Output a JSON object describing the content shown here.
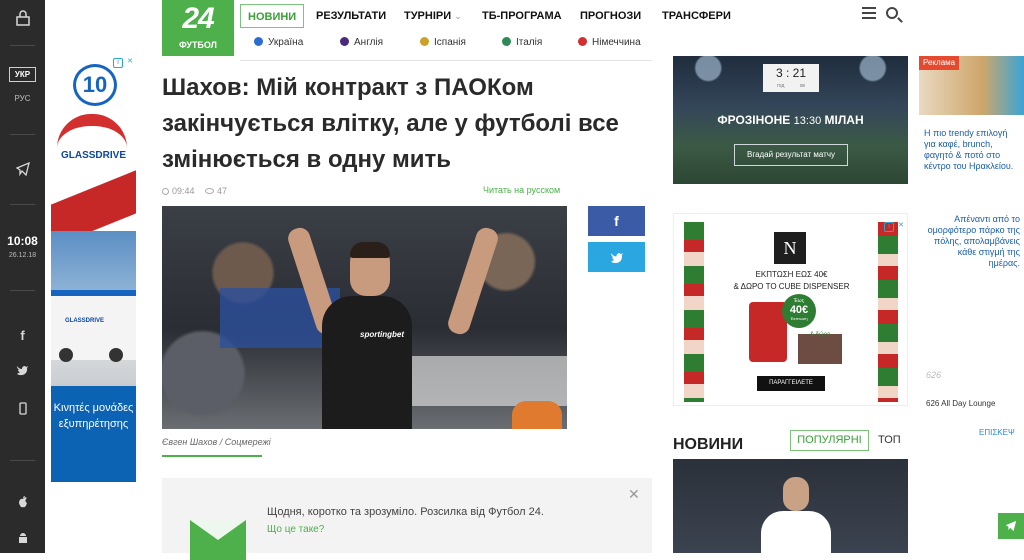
{
  "rail": {
    "lang_active": "УКР",
    "lang_other": "РУС",
    "time": "10:08",
    "date": "26.12.18"
  },
  "header": {
    "logo_number": "24",
    "logo_word": "ФУТБОЛ",
    "nav": [
      "НОВИНИ",
      "РЕЗУЛЬТАТИ",
      "ТУРНІРИ",
      "ТБ-ПРОГРАМА",
      "ПРОГНОЗИ",
      "ТРАНСФЕРИ"
    ],
    "leagues": [
      {
        "label": "Україна",
        "color": "#2b6cd1"
      },
      {
        "label": "Англія",
        "color": "#4a2a7a"
      },
      {
        "label": "Іспанія",
        "color": "#c9a227"
      },
      {
        "label": "Італія",
        "color": "#2e8b57"
      },
      {
        "label": "Німеччина",
        "color": "#d32f2f"
      }
    ]
  },
  "left_ad": {
    "logo_number": "10",
    "brand": "GLASSDRIVE",
    "van_brand": "GLASSDRIVE",
    "cta": "Κινητές μονάδες εξυπηρέτησης"
  },
  "article": {
    "headline": "Шахов: Мій контракт з ПАОКом закінчується влітку, але у футболі все змінюється в одну мить",
    "time": "09:44",
    "views": "47",
    "read_ru": "Читать на русском",
    "photo_sponsor": "sportingbet",
    "caption": "Євген Шахов / Соцмережі"
  },
  "share": {
    "facebook": "f",
    "twitter": "t"
  },
  "newsletter": {
    "text": "Щодня, коротко та зрозуміло. Розсилка від Футбол 24.",
    "link": "Що це таке?",
    "close": "✕"
  },
  "match": {
    "hours": "3",
    "minutes": "21",
    "units": "год хв",
    "home": "ФРОЗІНОНЕ",
    "time": "13:30",
    "away": "МІЛАН",
    "button": "Вгадай результат матчу"
  },
  "right_ad": {
    "logo": "N",
    "line1": "ΕΚΠΤΩΣΗ ΕΩΣ 40€",
    "line2": "& ΔΩΡΟ ΤΟ CUBE DISPENSER",
    "badge_top": "Έως",
    "badge_value": "40€",
    "badge_bottom": "Έκπτωση",
    "gift": "& δώρο",
    "button": "ΠΑΡΑΓΓΕΙΛΕΤΕ"
  },
  "news": {
    "title": "НОВИНИ",
    "tab_popular": "ПОПУЛЯРНІ",
    "tab_top": "ТОП"
  },
  "far_ad": {
    "tag": "Реклама",
    "text1": "Η πιο trendy επιλογή για καφέ, brunch, φαγητό & ποτό στο κέντρο του Ηρακλείου.",
    "text2": "Απέναντι από το ομορφότερο πάρκο της πόλης, απολαμβάνεις κάθε στιγμή της ημέρας.",
    "logo": "626",
    "name": "626 All Day Lounge",
    "more": "ΕΠΙΣΚΕΨ"
  }
}
